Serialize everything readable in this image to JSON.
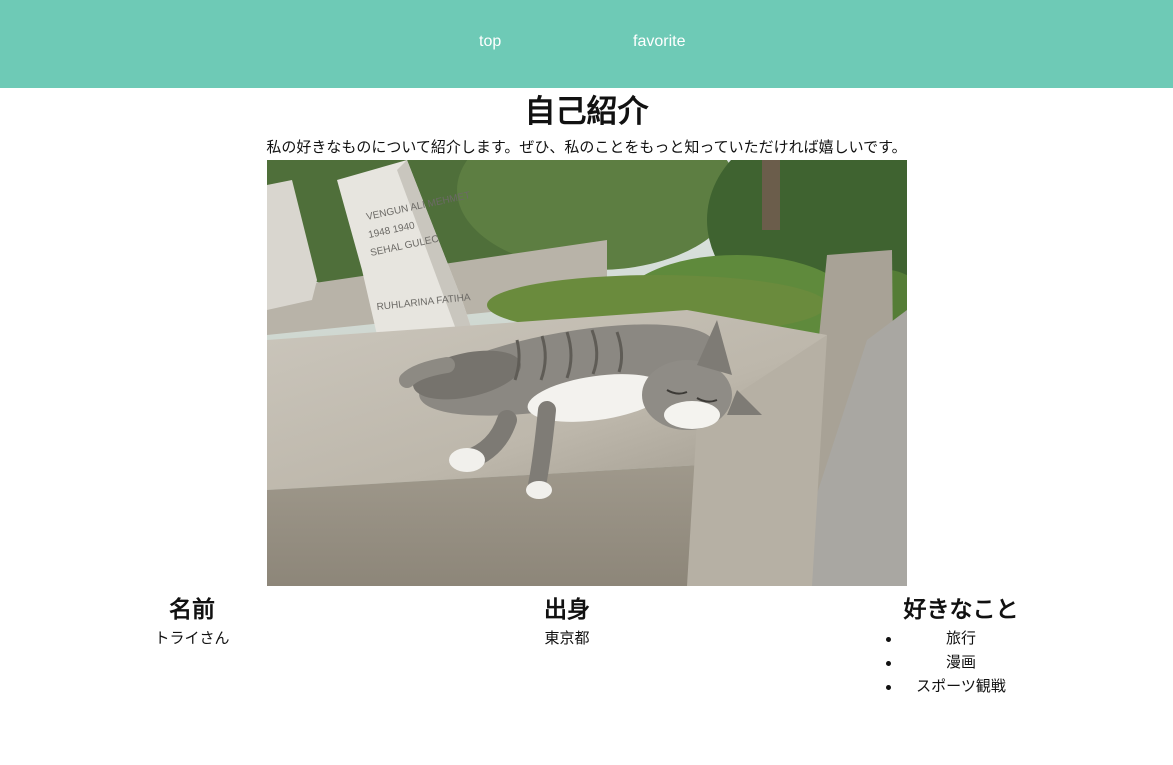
{
  "nav": {
    "top_label": "top",
    "favorite_label": "favorite",
    "bg_color": "#6ecab6"
  },
  "main": {
    "title": "自己紹介",
    "intro": "私の好きなものについて紹介します。ぜひ、私のことをもっと知っていただければ嬉しいです。"
  },
  "profile": {
    "name_heading": "名前",
    "name_value": "トライさん",
    "origin_heading": "出身",
    "origin_value": "東京都",
    "likes_heading": "好きなこと",
    "likes": [
      "旅行",
      "漫画",
      "スポーツ観戦"
    ]
  }
}
